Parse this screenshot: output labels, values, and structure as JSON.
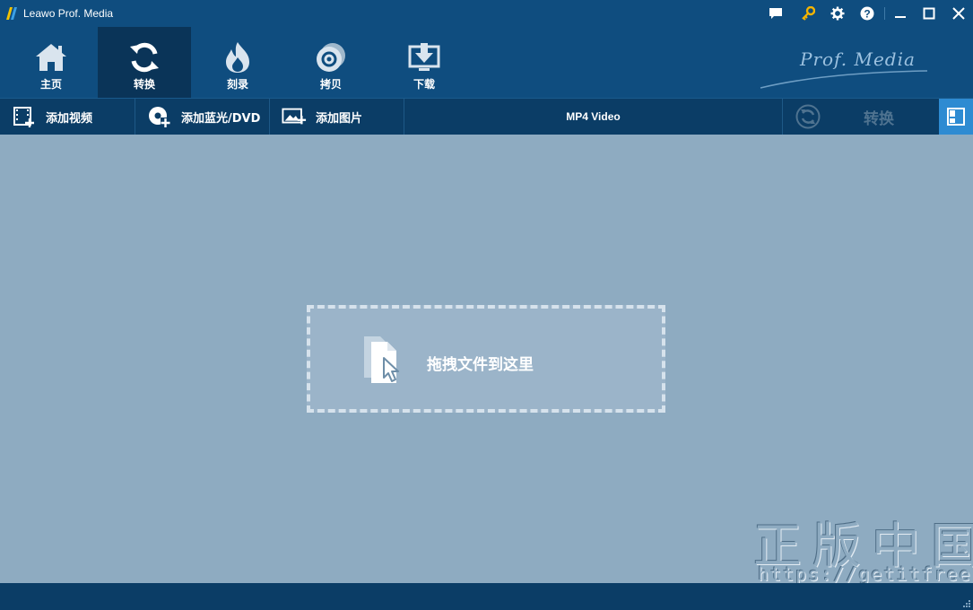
{
  "window": {
    "title": "Leawo Prof. Media",
    "controls": [
      "chat-icon",
      "key-icon",
      "gear-icon",
      "help-icon",
      "minimize-icon",
      "maximize-icon",
      "close-icon"
    ]
  },
  "nav": {
    "items": [
      {
        "label": "主页",
        "icon": "home-icon"
      },
      {
        "label": "转换",
        "icon": "convert-icon",
        "active": true
      },
      {
        "label": "刻录",
        "icon": "burn-icon"
      },
      {
        "label": "拷贝",
        "icon": "copy-disc-icon"
      },
      {
        "label": "下载",
        "icon": "download-icon"
      }
    ],
    "brand": "Prof. Media"
  },
  "toolbar": {
    "add_video": "添加视频",
    "add_bluray": "添加蓝光/DVD",
    "add_photo": "添加图片",
    "format": "MP4 Video",
    "convert": "转换"
  },
  "dropzone": {
    "text": "拖拽文件到这里"
  },
  "watermark": {
    "title": "正版中国",
    "url": "https://getitfree.cn"
  },
  "colors": {
    "titlebar": "#0f4d7f",
    "nav_active": "#0a3458",
    "toolbar": "#0b3d66",
    "content": "#8eabc1",
    "accent": "#2e8bd2",
    "key_icon": "#f5b400"
  }
}
